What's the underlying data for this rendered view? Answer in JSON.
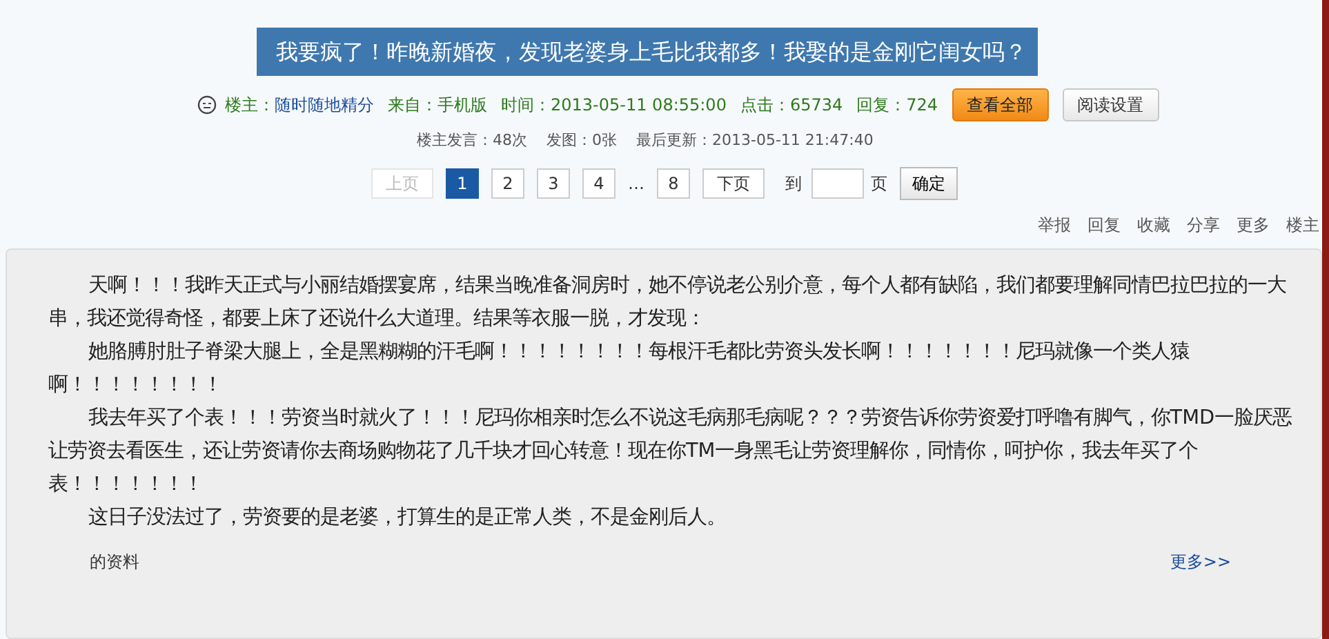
{
  "title": "我要疯了！昨晚新婚夜，发现老婆身上毛比我都多！我娶的是金刚它闺女吗？",
  "meta": [
    {
      "label": "楼主：",
      "value": "随时随地精分",
      "kind": "link"
    },
    {
      "label": "来自：",
      "value": "手机版",
      "kind": "text"
    },
    {
      "label": "时间：",
      "value": "2013-05-11 08:55:00",
      "kind": "text"
    },
    {
      "label": "点击：",
      "value": "65734",
      "kind": "text"
    },
    {
      "label": "回复：",
      "value": "724",
      "kind": "text"
    }
  ],
  "buttons": [
    {
      "label": "查看全部",
      "kind": "primary"
    },
    {
      "label": "阅读设置",
      "kind": "plain"
    }
  ],
  "stats": [
    "楼主发言：48次",
    "发图：0张",
    "最后更新：2013-05-11 21:47:40"
  ],
  "pagination": {
    "prev": {
      "label": "上页",
      "disabled": true
    },
    "pages": [
      {
        "label": "1",
        "selected": true
      },
      {
        "label": "2",
        "selected": false
      },
      {
        "label": "3",
        "selected": false
      },
      {
        "label": "4",
        "selected": false
      },
      {
        "label": "…",
        "kind": "ellipsis"
      },
      {
        "label": "8",
        "selected": false
      }
    ],
    "next": {
      "label": "下页",
      "disabled": false
    },
    "goto_label": "到",
    "page_unit": "页",
    "confirm": "确定"
  },
  "actions": [
    "举报",
    "回复",
    "收藏",
    "分享",
    "更多",
    "楼主"
  ],
  "post": {
    "paragraphs": [
      "天啊！！！我昨天正式与小丽结婚摆宴席，结果当晚准备洞房时，她不停说老公别介意，每个人都有缺陷，我们都要理解同情巴拉巴拉的一大串，我还觉得奇怪，都要上床了还说什么大道理。结果等衣服一脱，才发现：",
      "她胳膊肘肚子脊梁大腿上，全是黑糊糊的汗毛啊！！！！！！！！每根汗毛都比劳资头发长啊！！！！！！！尼玛就像一个类人猿啊！！！！！！！！",
      "我去年买了个表！！！劳资当时就火了！！！尼玛你相亲时怎么不说这毛病那毛病呢？？？劳资告诉你劳资爱打呼噜有脚气，你TMD一脸厌恶让劳资去看医生，还让劳资请你去商场购物花了几千块才回心转意！现在你TM一身黑毛让劳资理解你，同情你，呵护你，我去年买了个表！！！！！！！",
      "这日子没法过了，劳资要的是老婆，打算生的是正常人类，不是金刚后人。"
    ]
  },
  "footer": {
    "profile_link": "的资料",
    "more": "更多>>"
  }
}
